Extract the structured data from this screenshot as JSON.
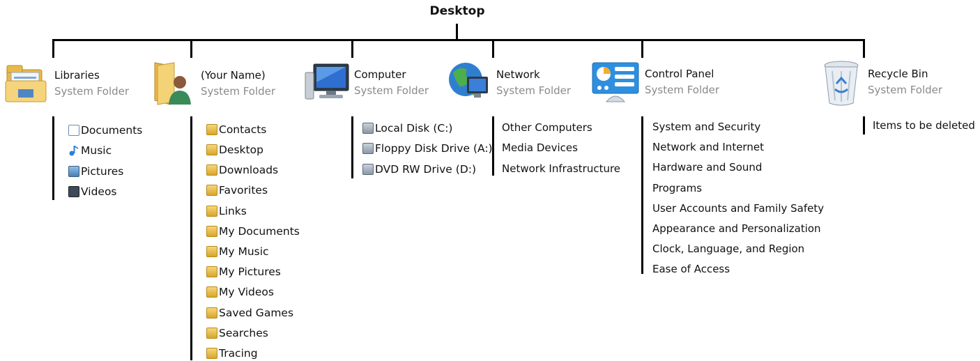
{
  "title": "Desktop",
  "nodes": {
    "libraries": {
      "name": "Libraries",
      "sub": "System Folder",
      "items": [
        {
          "label": "Documents",
          "icon": "documents-icon"
        },
        {
          "label": "Music",
          "icon": "music-note-icon"
        },
        {
          "label": "Pictures",
          "icon": "pictures-icon"
        },
        {
          "label": "Videos",
          "icon": "videos-icon"
        }
      ]
    },
    "user": {
      "name": "(Your Name)",
      "sub": "System Folder",
      "items": [
        {
          "label": "Contacts",
          "icon": "contacts-folder-icon"
        },
        {
          "label": "Desktop",
          "icon": "desktop-folder-icon"
        },
        {
          "label": "Downloads",
          "icon": "downloads-folder-icon"
        },
        {
          "label": "Favorites",
          "icon": "favorites-folder-icon"
        },
        {
          "label": "Links",
          "icon": "links-folder-icon"
        },
        {
          "label": "My Documents",
          "icon": "documents-folder-icon"
        },
        {
          "label": "My Music",
          "icon": "music-folder-icon"
        },
        {
          "label": "My Pictures",
          "icon": "pictures-folder-icon"
        },
        {
          "label": "My Videos",
          "icon": "videos-folder-icon"
        },
        {
          "label": "Saved Games",
          "icon": "saved-games-folder-icon"
        },
        {
          "label": "Searches",
          "icon": "searches-folder-icon"
        },
        {
          "label": "Tracing",
          "icon": "folder-icon"
        }
      ]
    },
    "computer": {
      "name": "Computer",
      "sub": "System Folder",
      "items": [
        {
          "label": "Local Disk (C:)",
          "icon": "local-disk-icon"
        },
        {
          "label": "Floppy Disk Drive (A:)",
          "icon": "floppy-drive-icon"
        },
        {
          "label": "DVD RW Drive (D:)",
          "icon": "dvd-drive-icon"
        }
      ]
    },
    "network": {
      "name": "Network",
      "sub": "System Folder",
      "items": [
        "Other Computers",
        "Media Devices",
        "Network Infrastructure"
      ]
    },
    "control_panel": {
      "name": "Control Panel",
      "sub": "System Folder",
      "items": [
        "System and Security",
        "Network and Internet",
        "Hardware and Sound",
        "Programs",
        "User Accounts and Family Safety",
        "Appearance and Personalization",
        "Clock, Language, and Region",
        "Ease of Access"
      ]
    },
    "recycle_bin": {
      "name": "Recycle Bin",
      "sub": "System Folder",
      "items": [
        "Items to be deleted"
      ]
    }
  }
}
